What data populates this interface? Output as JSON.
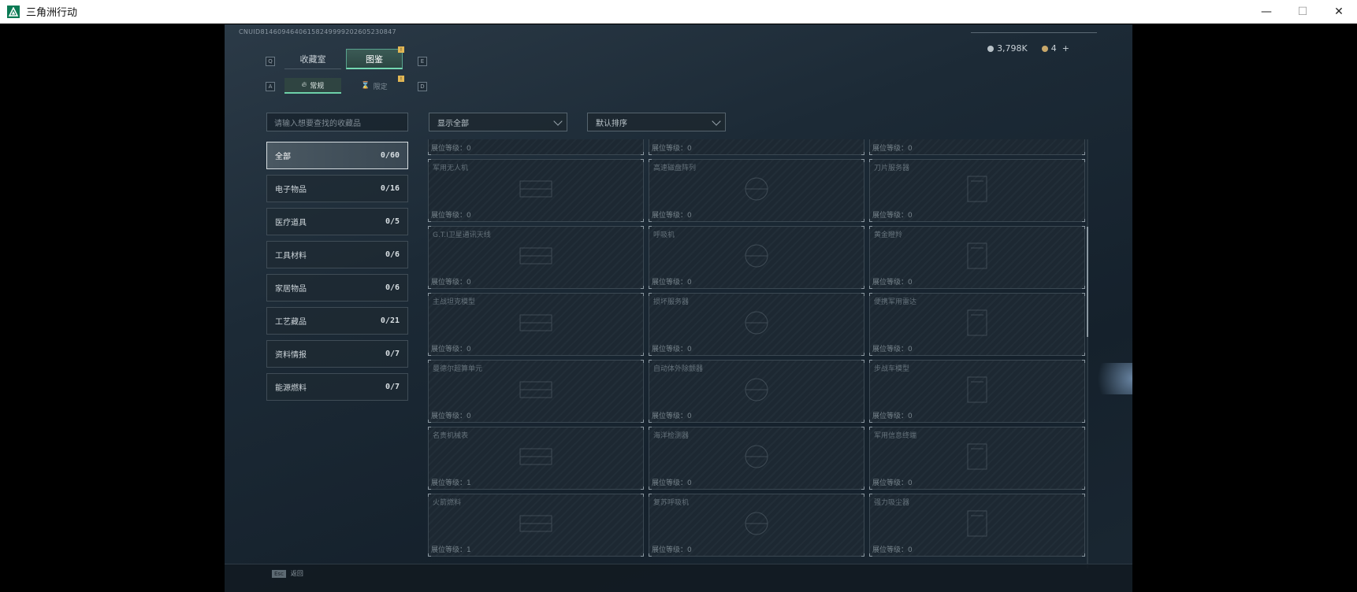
{
  "window": {
    "title": "三角洲行动",
    "controls": {
      "minimize": "—",
      "maximize": "☐",
      "close": "✕"
    }
  },
  "uid": "CNUID814609464061582499992026052308​47",
  "currency": {
    "silver": "3,798K",
    "gold": "4",
    "plus": "+"
  },
  "keys": {
    "tab_left": "Q",
    "tab_right": "E",
    "sub_left": "A",
    "sub_right": "D"
  },
  "tabs": [
    {
      "label": "收藏室",
      "active": false
    },
    {
      "label": "图鉴",
      "active": true,
      "badge": "!"
    }
  ],
  "sub_tabs": [
    {
      "label": "常规",
      "active": true
    },
    {
      "label": "限定",
      "active": false,
      "badge": "!"
    }
  ],
  "search": {
    "placeholder": "请输入想要查找的收藏品"
  },
  "filters": {
    "display": "显示全部",
    "sort": "默认排序"
  },
  "categories": [
    {
      "label": "全部",
      "count": "0/60",
      "active": true
    },
    {
      "label": "电子物品",
      "count": "0/16"
    },
    {
      "label": "医疗道具",
      "count": "0/5"
    },
    {
      "label": "工具材料",
      "count": "0/6"
    },
    {
      "label": "家居物品",
      "count": "0/6"
    },
    {
      "label": "工艺藏品",
      "count": "0/21"
    },
    {
      "label": "资料情报",
      "count": "0/7"
    },
    {
      "label": "能源燃料",
      "count": "0/7"
    }
  ],
  "cards": [
    {
      "name": "",
      "level": "展位等级：0"
    },
    {
      "name": "",
      "level": "展位等级：0"
    },
    {
      "name": "",
      "level": "展位等级：0"
    },
    {
      "name": "军用无人机",
      "level": "展位等级：0"
    },
    {
      "name": "高速磁盘阵列",
      "level": "展位等级：0"
    },
    {
      "name": "刀片服务器",
      "level": "展位等级：0"
    },
    {
      "name": "G.T.I卫星通讯天线",
      "level": "展位等级：0"
    },
    {
      "name": "呼吸机",
      "level": "展位等级：0"
    },
    {
      "name": "黄金瞪羚",
      "level": "展位等级：0"
    },
    {
      "name": "主战坦克模型",
      "level": "展位等级：0"
    },
    {
      "name": "损坏服务器",
      "level": "展位等级：0"
    },
    {
      "name": "便携军用雷达",
      "level": "展位等级：0"
    },
    {
      "name": "曼德尔超算单元",
      "level": "展位等级：0"
    },
    {
      "name": "自动体外除颤器",
      "level": "展位等级：0"
    },
    {
      "name": "步战车模型",
      "level": "展位等级：0"
    },
    {
      "name": "名贵机械表",
      "level": "展位等级：1"
    },
    {
      "name": "海洋检测器",
      "level": "展位等级：0"
    },
    {
      "name": "军用信息终端",
      "level": "展位等级：0"
    },
    {
      "name": "火箭燃料",
      "level": "展位等级：1"
    },
    {
      "name": "复苏呼吸机",
      "level": "展位等级：0"
    },
    {
      "name": "强力吸尘器",
      "level": "展位等级：0"
    }
  ],
  "bottom": {
    "esc_key": "Esc",
    "esc_label": "返回"
  }
}
